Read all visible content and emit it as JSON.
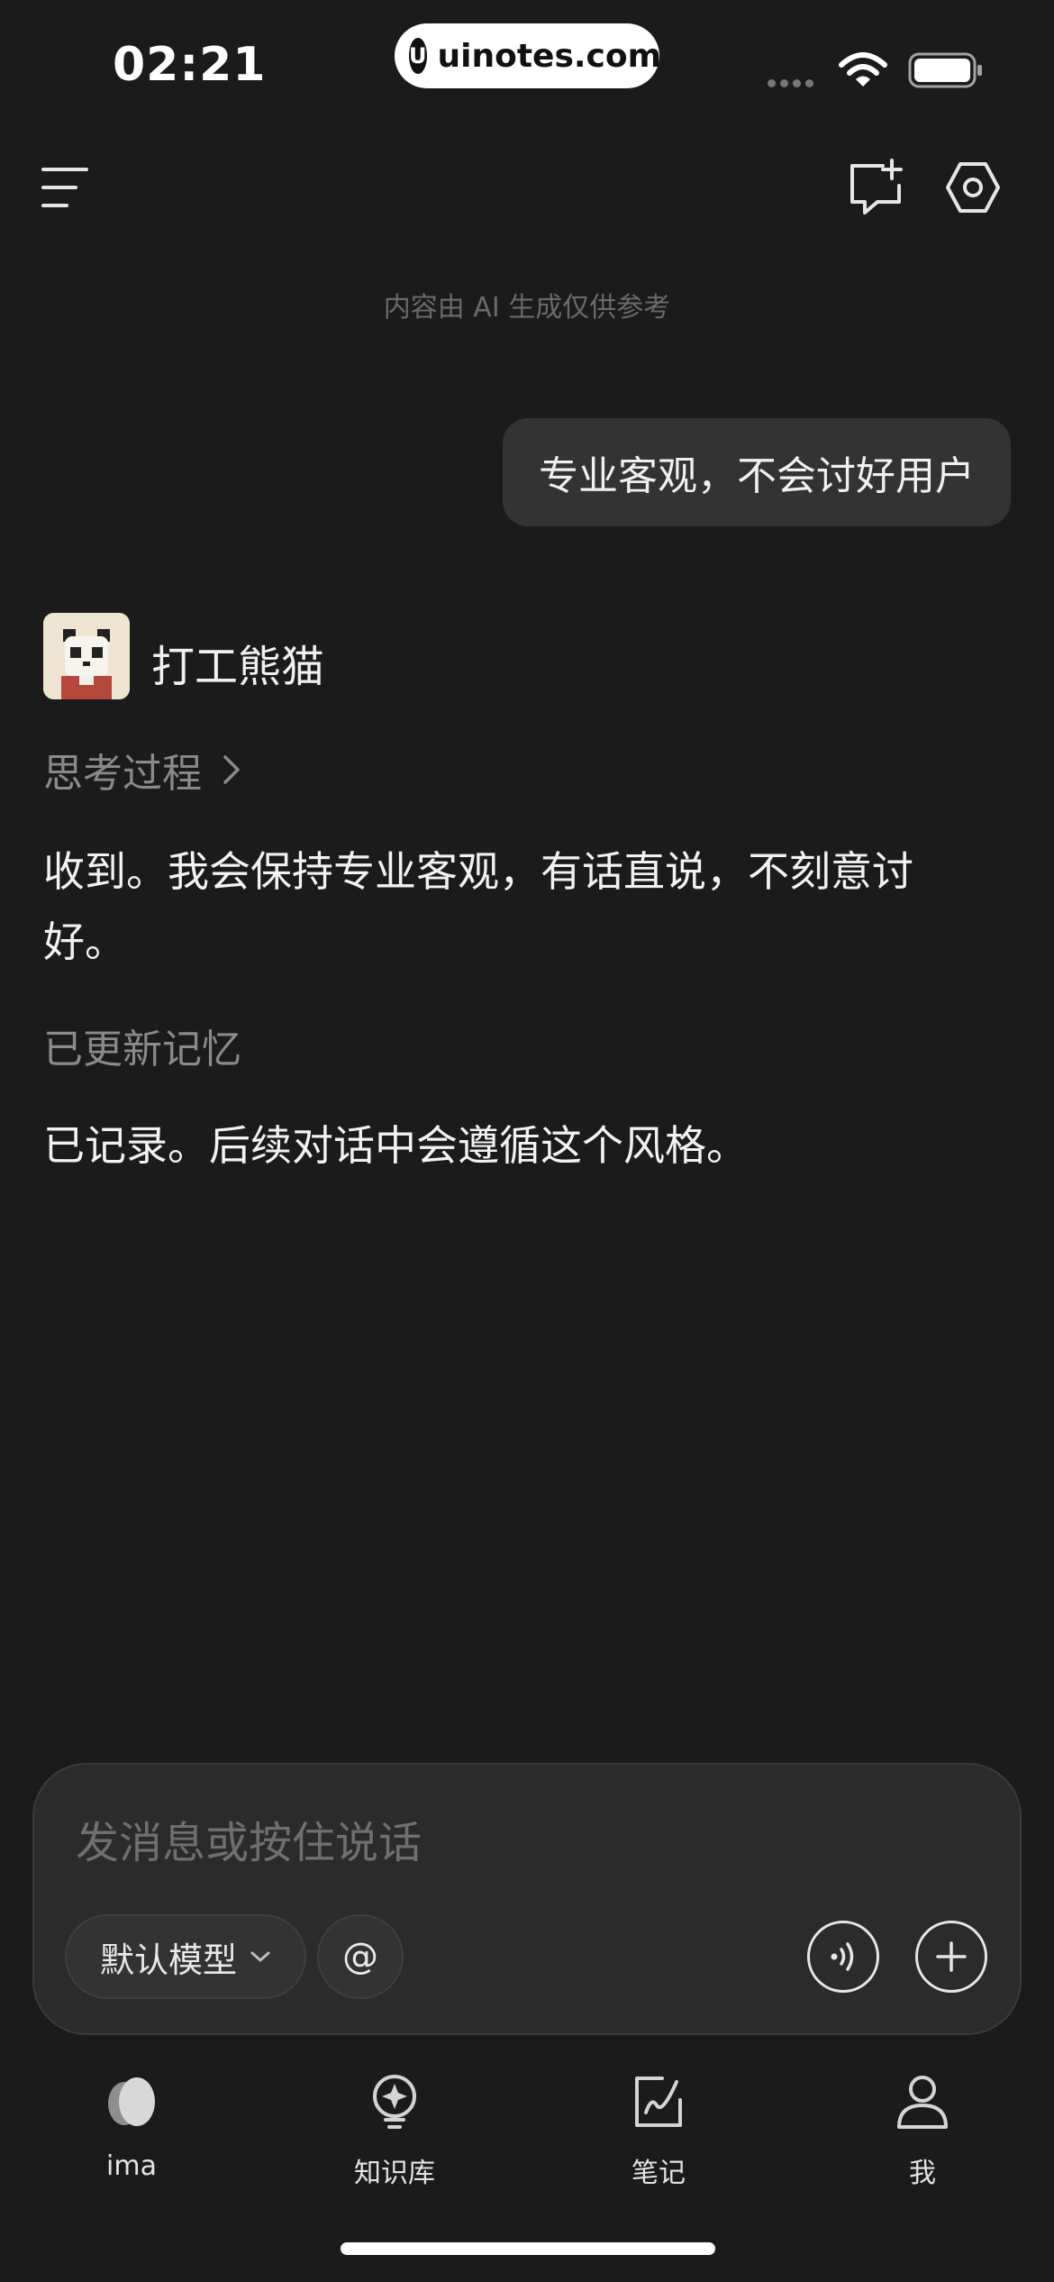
{
  "status_bar": {
    "time": "02:21",
    "site": "uinotes.com",
    "site_logo": "U"
  },
  "header": {
    "disclaimer": "内容由 AI 生成仅供参考"
  },
  "conversation": {
    "user_message": "专业客观，不会讨好用户",
    "bot_name": "打工熊猫",
    "thinking_label": "思考过程",
    "reply_1": "收到。我会保持专业客观，有话直说，不刻意讨好。",
    "memory_label": "已更新记忆",
    "reply_2": "已记录。后续对话中会遵循这个风格。"
  },
  "composer": {
    "placeholder": "发消息或按住说话",
    "model_label": "默认模型",
    "mention_label": "@"
  },
  "tabbar": {
    "items": [
      {
        "label": "ima",
        "icon": "ima-logo-icon"
      },
      {
        "label": "知识库",
        "icon": "knowledge-base-icon"
      },
      {
        "label": "笔记",
        "icon": "notes-icon"
      },
      {
        "label": "我",
        "icon": "profile-icon"
      }
    ]
  },
  "colors": {
    "background": "#1b1b1b",
    "bubble": "#333333",
    "muted_text": "#8a8a8a"
  }
}
